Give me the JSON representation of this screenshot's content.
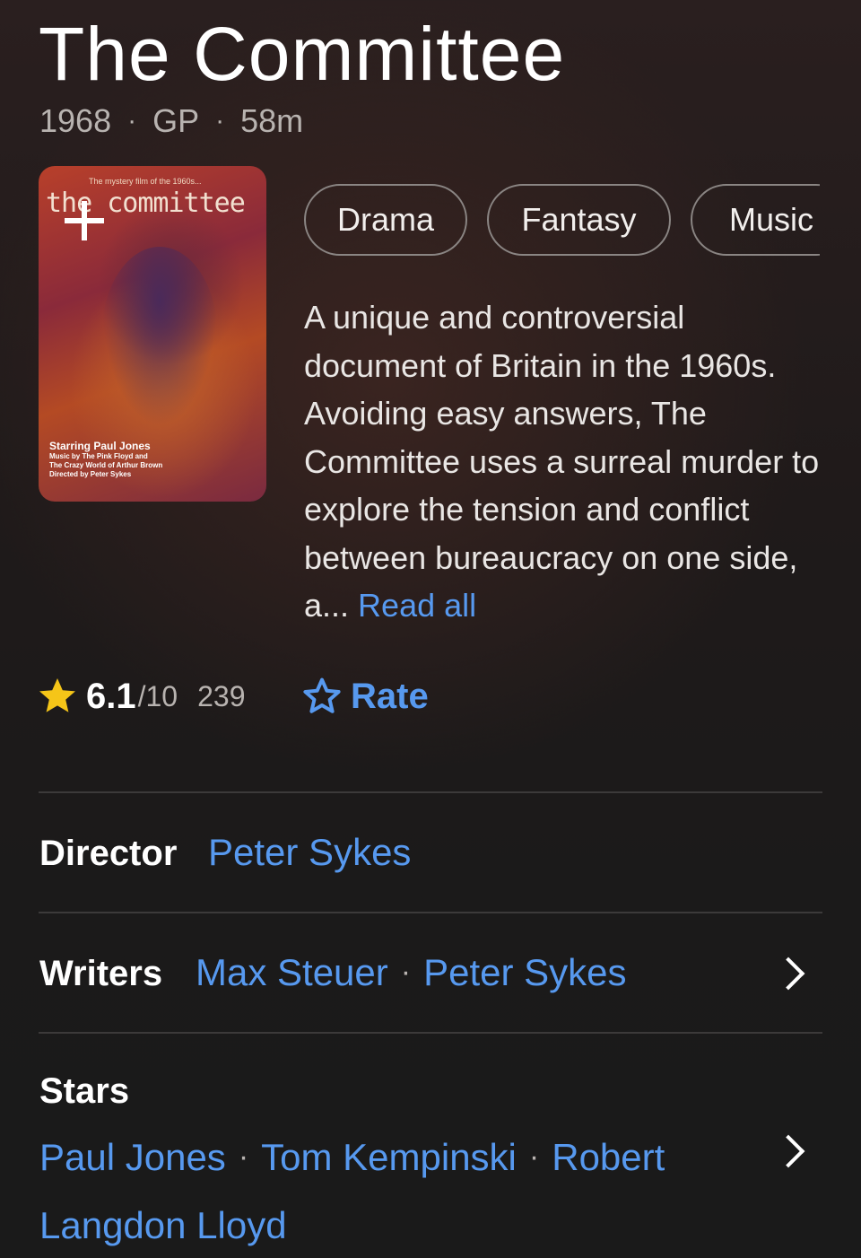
{
  "title": "The Committee",
  "meta": {
    "year": "1968",
    "rating": "GP",
    "runtime": "58m",
    "separator": "·"
  },
  "poster": {
    "tagline": "The mystery film of the 1960s...",
    "title_art": "the committee",
    "credits": [
      "Starring Paul Jones",
      "Music by The Pink Floyd and",
      "The Crazy World of Arthur Brown",
      "Directed by Peter Sykes"
    ],
    "watchlist_icon": "plus-icon"
  },
  "genres": [
    "Drama",
    "Fantasy",
    "Music"
  ],
  "description": {
    "text": "A unique and controversial document of Britain in the 1960s. Avoiding easy answers, The Committee uses a surreal murder to explore the tension and conflict between bureaucracy on one side, a...",
    "read_all": "Read all"
  },
  "rating": {
    "score": "6.1",
    "out_of": "/10",
    "votes": "239",
    "icon": "star-filled-icon"
  },
  "rate": {
    "label": "Rate",
    "icon": "star-outline-icon"
  },
  "director": {
    "label": "Director",
    "names": [
      "Peter Sykes"
    ]
  },
  "writers": {
    "label": "Writers",
    "names": [
      "Max Steuer",
      "Peter Sykes"
    ],
    "separator": "·"
  },
  "stars": {
    "label": "Stars",
    "names": [
      "Paul Jones",
      "Tom Kempinski",
      "Robert"
    ],
    "wrap": "Langdon Lloyd",
    "separator": "·"
  },
  "colors": {
    "accent": "#5799ef",
    "star": "#f5c518",
    "text_muted": "#b8b3b0"
  }
}
